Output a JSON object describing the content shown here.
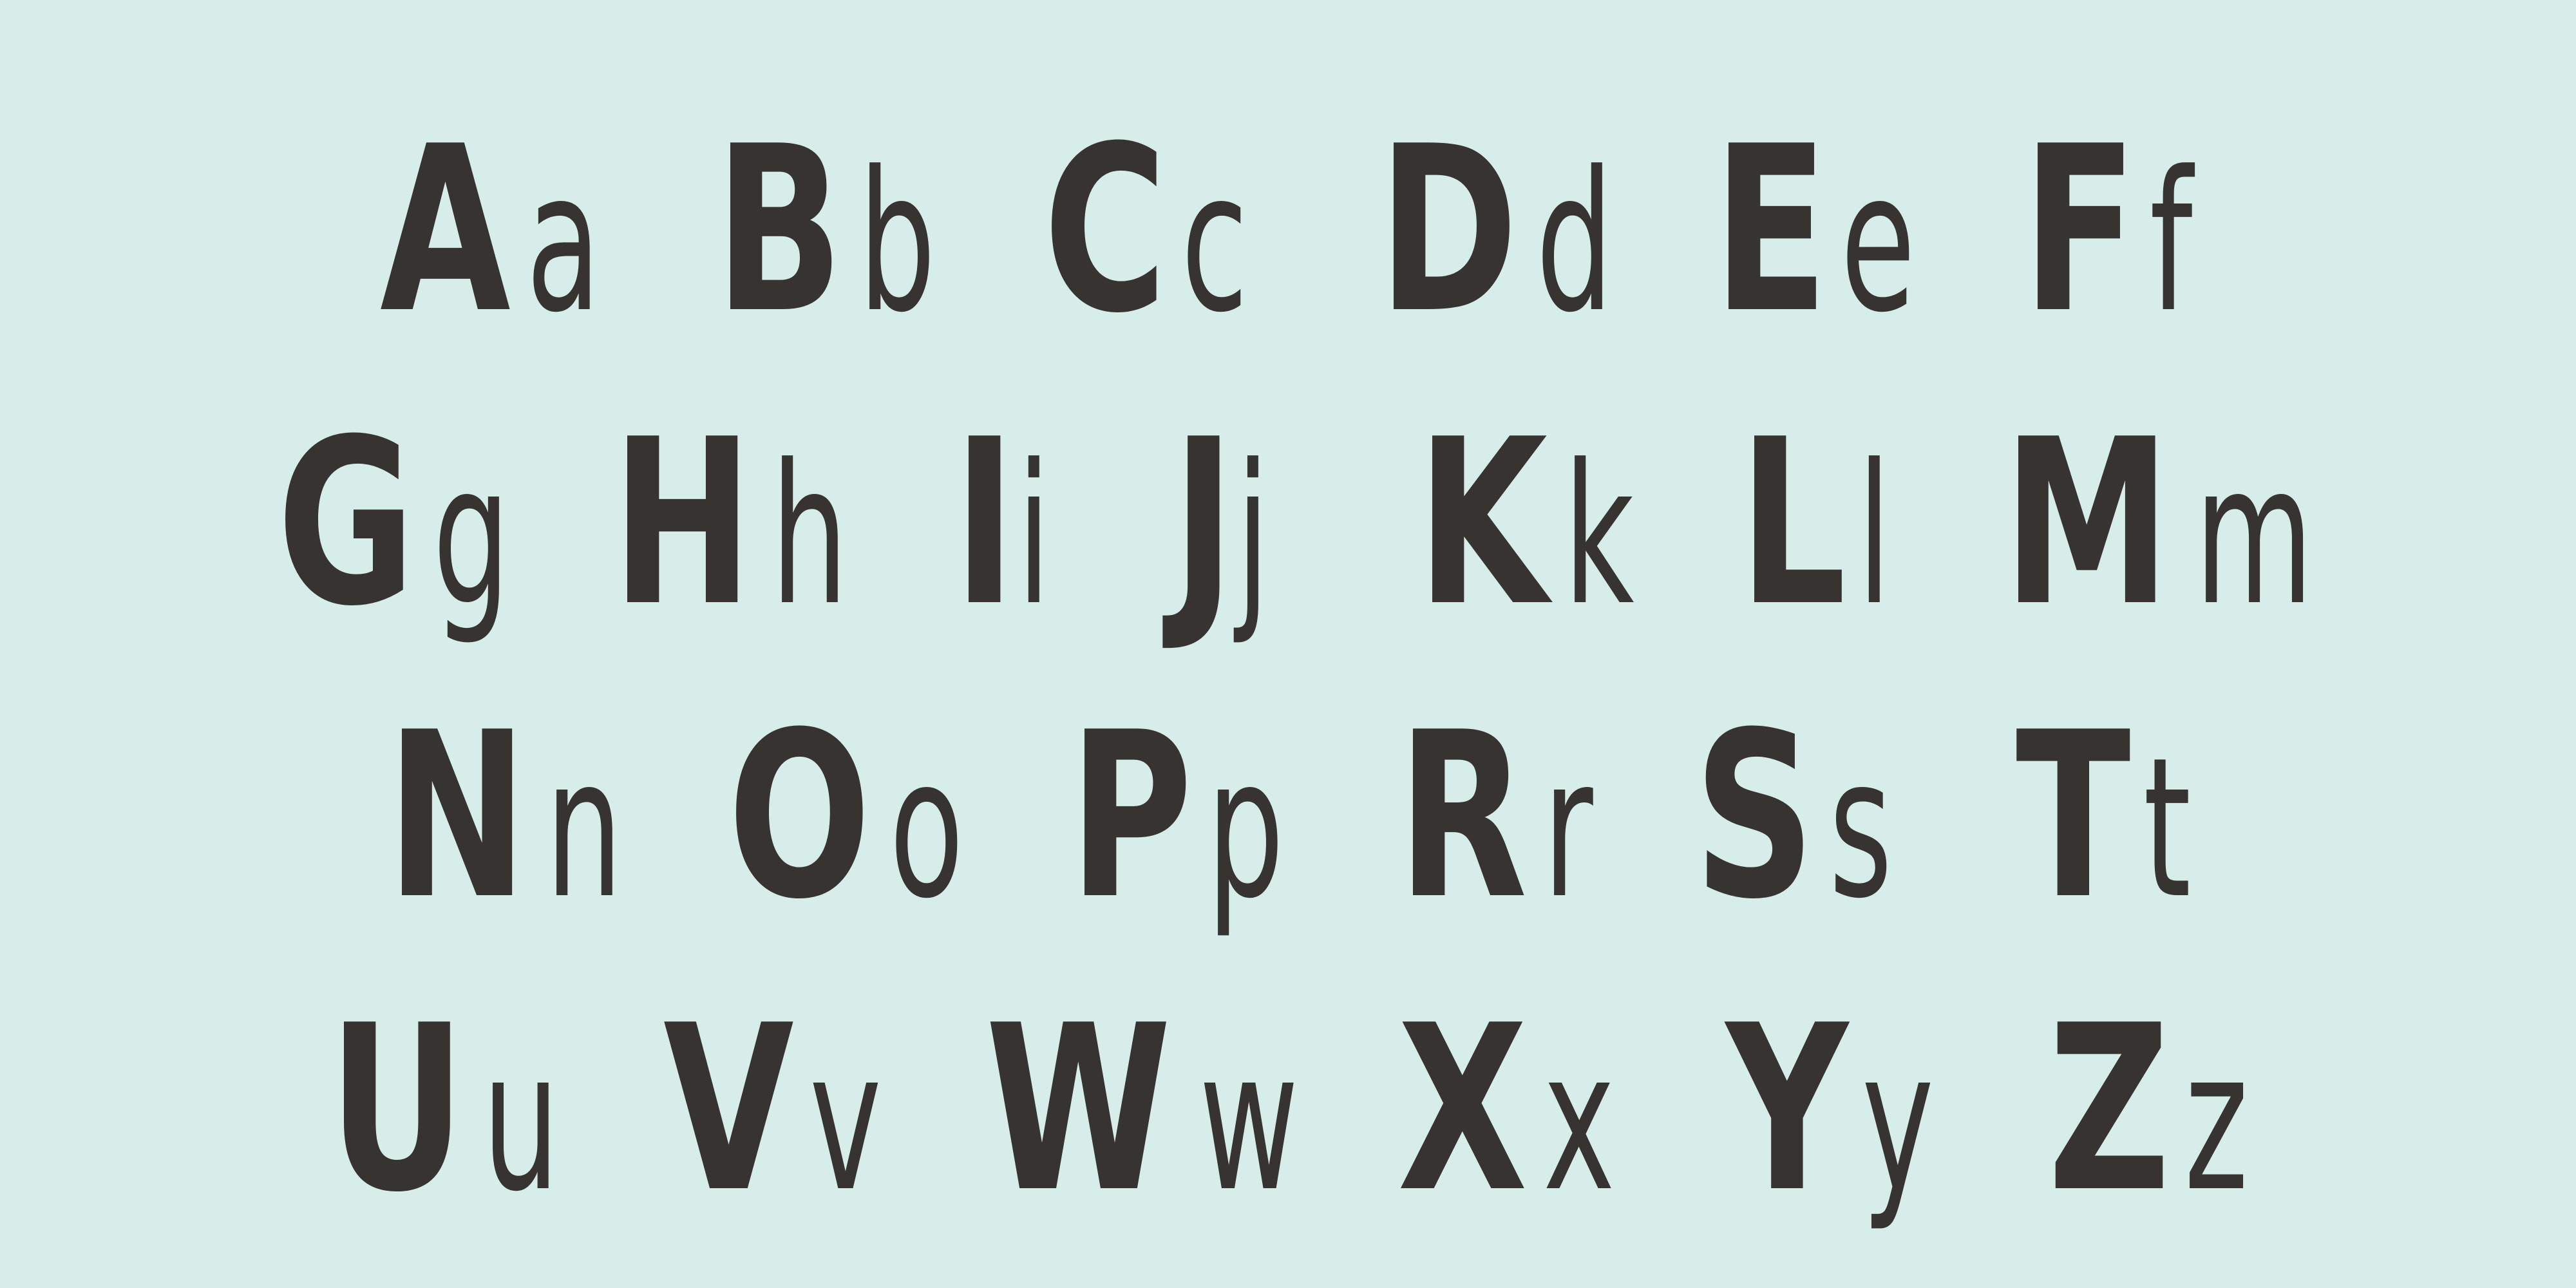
{
  "specimen": {
    "colors": {
      "background": "#d7ede9",
      "ink": "#363330"
    },
    "rows": [
      [
        {
          "upper": "A",
          "lower": "a"
        },
        {
          "upper": "B",
          "lower": "b"
        },
        {
          "upper": "C",
          "lower": "c"
        },
        {
          "upper": "D",
          "lower": "d"
        },
        {
          "upper": "E",
          "lower": "e"
        },
        {
          "upper": "F",
          "lower": "f"
        }
      ],
      [
        {
          "upper": "G",
          "lower": "g"
        },
        {
          "upper": "H",
          "lower": "h"
        },
        {
          "upper": "I",
          "lower": "i"
        },
        {
          "upper": "J",
          "lower": "j"
        },
        {
          "upper": "K",
          "lower": "k"
        },
        {
          "upper": "L",
          "lower": "l"
        },
        {
          "upper": "M",
          "lower": "m"
        }
      ],
      [
        {
          "upper": "N",
          "lower": "n"
        },
        {
          "upper": "O",
          "lower": "o"
        },
        {
          "upper": "P",
          "lower": "p"
        },
        {
          "upper": "R",
          "lower": "r"
        },
        {
          "upper": "S",
          "lower": "s"
        },
        {
          "upper": "T",
          "lower": "t"
        }
      ],
      [
        {
          "upper": "U",
          "lower": "u"
        },
        {
          "upper": "V",
          "lower": "v"
        },
        {
          "upper": "W",
          "lower": "w"
        },
        {
          "upper": "X",
          "lower": "x"
        },
        {
          "upper": "Y",
          "lower": "y"
        },
        {
          "upper": "Z",
          "lower": "z"
        }
      ]
    ]
  }
}
